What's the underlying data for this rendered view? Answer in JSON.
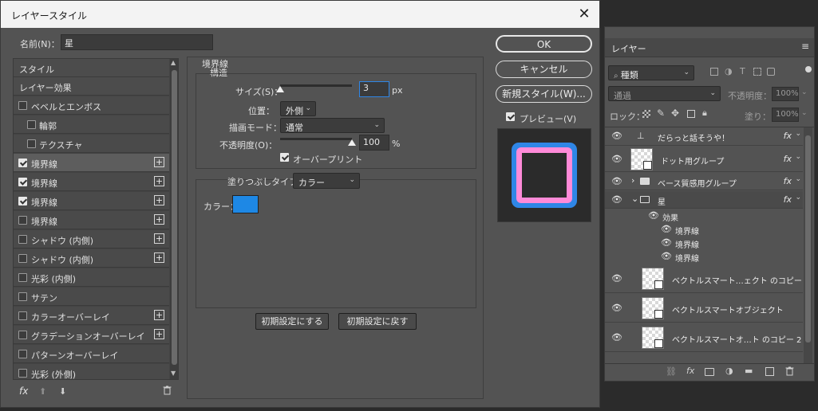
{
  "dialog": {
    "title": "レイヤースタイル",
    "close": "✕",
    "name_label": "名前(N)：",
    "name_value": "星",
    "style_list": [
      {
        "label": "スタイル",
        "type": "head"
      },
      {
        "label": "レイヤー効果",
        "type": "head"
      },
      {
        "label": "ベベルとエンボス",
        "type": "check",
        "checked": false
      },
      {
        "label": "輪郭",
        "type": "sub",
        "checked": false
      },
      {
        "label": "テクスチャ",
        "type": "sub",
        "checked": false
      },
      {
        "label": "境界線",
        "type": "check",
        "checked": true,
        "plus": true,
        "selected": true
      },
      {
        "label": "境界線",
        "type": "check",
        "checked": true,
        "plus": true
      },
      {
        "label": "境界線",
        "type": "check",
        "checked": true,
        "plus": true
      },
      {
        "label": "境界線",
        "type": "check",
        "checked": false,
        "plus": true
      },
      {
        "label": "シャドウ (内側)",
        "type": "check",
        "checked": false,
        "plus": true
      },
      {
        "label": "シャドウ (内側)",
        "type": "check",
        "checked": false,
        "plus": true
      },
      {
        "label": "光彩 (内側)",
        "type": "check",
        "checked": false
      },
      {
        "label": "サテン",
        "type": "check",
        "checked": false
      },
      {
        "label": "カラーオーバーレイ",
        "type": "check",
        "checked": false,
        "plus": true
      },
      {
        "label": "グラデーションオーバーレイ",
        "type": "check",
        "checked": false,
        "plus": true
      },
      {
        "label": "パターンオーバーレイ",
        "type": "check",
        "checked": false
      },
      {
        "label": "光彩 (外側)",
        "type": "check",
        "checked": false
      }
    ],
    "bottom_icons": {
      "fx": "fx",
      "up": "⬆",
      "down": "⬇",
      "trash": "🗑"
    },
    "stroke": {
      "section_title": "境界線",
      "subsection_title": "構造",
      "size_label": "サイズ(S)：",
      "size_value": "3",
      "size_unit": "px",
      "size_slider": 0.0,
      "position_label": "位置：",
      "position_value": "外側",
      "blend_label": "描画モード：",
      "blend_value": "通常",
      "opacity_label": "不透明度(O)：",
      "opacity_value": "100",
      "opacity_unit": "%",
      "opacity_slider": 1.0,
      "overprint_label": "オーバープリント",
      "fill_type_label": "塗りつぶしタイプ：",
      "fill_type_value": "カラー",
      "color_label": "カラー：",
      "color_value": "#1e88e5"
    },
    "buttons": {
      "ok": "OK",
      "cancel": "キャンセル",
      "new_style": "新規スタイル(W)...",
      "preview": "プレビュー(V)",
      "reset_default": "初期設定にする",
      "restore_default": "初期設定に戻す"
    },
    "preview_colors": {
      "fill": "#2b2b2b",
      "inner": "#ff8ad8",
      "outer": "#2f86e6"
    }
  },
  "layers_panel": {
    "collapse": "«",
    "close": "✕",
    "tab": "レイヤー",
    "menu_icon": "≡",
    "filter_value": "種類",
    "blend_value": "通過",
    "opacity_label": "不透明度：",
    "opacity_value": "100%",
    "lock_label": "ロック：",
    "fill_label": "塗り：",
    "fill_value": "100%",
    "layers": [
      {
        "name": "だらっと話そうや！",
        "kind": "text",
        "fx": true
      },
      {
        "name": "ドット用グループ",
        "kind": "smart",
        "fx": true
      },
      {
        "name": "ベース質感用グループ",
        "kind": "folder",
        "fx": true
      },
      {
        "name": "星",
        "kind": "folder-open",
        "fx": true,
        "selected": true
      },
      {
        "name": "効果",
        "kind": "effects"
      },
      {
        "name": "境界線",
        "kind": "effect"
      },
      {
        "name": "境界線",
        "kind": "effect"
      },
      {
        "name": "境界線",
        "kind": "effect"
      },
      {
        "name": "ベクトルスマート…ェクト のコピー",
        "kind": "smart"
      },
      {
        "name": "ベクトルスマートオブジェクト",
        "kind": "smart"
      },
      {
        "name": "ベクトルスマートオ…ト のコピー 2",
        "kind": "smart"
      }
    ],
    "footer_icons": [
      "link-icon",
      "fx-icon",
      "mask-icon",
      "adjustment-icon",
      "folder-icon",
      "new-layer-icon",
      "trash-icon"
    ]
  }
}
